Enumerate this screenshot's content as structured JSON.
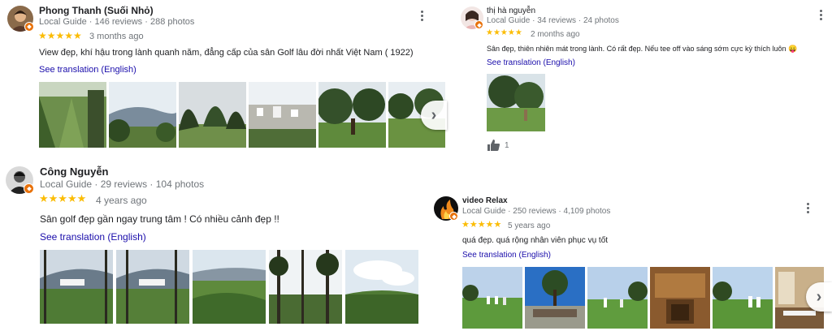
{
  "colors": {
    "star": "#fbbc04",
    "link": "#1a0dab",
    "muted": "#70757a",
    "badge": "#e8710a"
  },
  "reviews": [
    {
      "name": "Phong Thanh (Suối Nhỏ)",
      "meta": "Local Guide · 146 reviews · 288 photos",
      "stars": "★★★★★",
      "date": "3 months ago",
      "text": "View đẹp, khí hậu trong lành quanh năm, đẳng cấp của sân Golf lâu đời nhất Việt Nam ( 1922)",
      "translate": "See translation (English)",
      "rating": 5
    },
    {
      "name": "Công Nguyễn",
      "meta": "Local Guide · 29 reviews · 104 photos",
      "stars": "★★★★★",
      "date": "4 years ago",
      "text": "Sân golf đẹp gần ngay trung tâm ! Có nhiều cảnh đẹp !!",
      "translate": "See translation (English)",
      "rating": 5
    },
    {
      "name": "thị hà nguyễn",
      "meta": "Local Guide · 34 reviews · 24 photos",
      "stars": "★★★★★",
      "date": "2 months ago",
      "text": "Sân đẹp, thiên nhiên mát trong lành. Có rất đẹp. Nếu tee off vào sáng sớm cực kỳ thích luôn 😛",
      "translate": "See translation (English)",
      "likes": "1",
      "rating": 5
    },
    {
      "name": "video Relax",
      "meta": "Local Guide · 250 reviews · 4,109 photos",
      "stars": "★★★★★",
      "date": "5 years ago",
      "text": "quá đẹp. quá rộng  nhân viên phục vụ tốt",
      "translate": "See translation (English)",
      "rating": 5
    }
  ],
  "icons": {
    "more": "more-vert-icon",
    "next": "chevron-right-icon",
    "like": "thumb-up-icon",
    "badge": "local-guide-badge-icon"
  }
}
